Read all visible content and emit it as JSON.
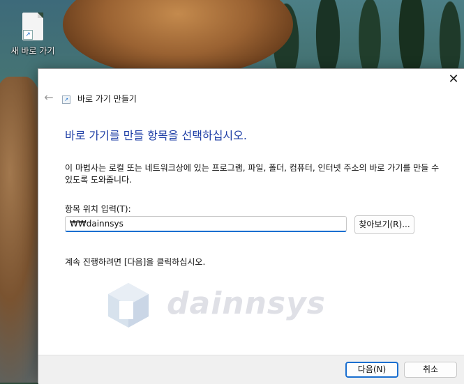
{
  "desktop": {
    "icon_label": "새 바로 가기"
  },
  "dialog": {
    "title": "바로 가기 만들기",
    "back_icon": "back-arrow-icon",
    "close_icon": "close-icon",
    "heading": "바로 가기를 만들 항목을 선택하십시오.",
    "description": "이 마법사는 로컬 또는 네트워크상에 있는 프로그램, 파일, 폴더, 컴퓨터, 인터넷 주소의 바로 가기를 만들 수 있도록 도와줍니다.",
    "location_label": "항목 위치 입력(T):",
    "location_value": "₩₩dainnsys",
    "browse_label": "찾아보기(R)...",
    "instruction": "계속 진행하려면 [다음]을 클릭하십시오.",
    "next_label": "다음(N)",
    "cancel_label": "취소"
  },
  "watermark": {
    "text": "dainnsys"
  },
  "colors": {
    "accent": "#1a6fd0",
    "heading": "#1f3fa6"
  }
}
